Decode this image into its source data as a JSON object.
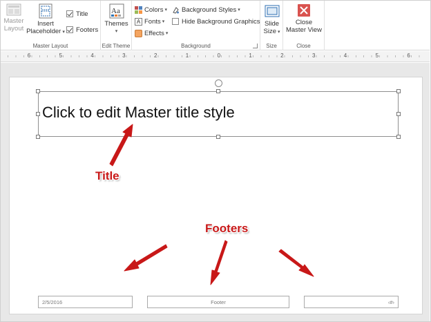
{
  "ribbon": {
    "master_layout": {
      "master_layout_label_1": "Master",
      "master_layout_label_2": "Layout",
      "insert_placeholder_label_1": "Insert",
      "insert_placeholder_label_2": "Placeholder",
      "title_checkbox": {
        "label": "Title",
        "checked": true
      },
      "footers_checkbox": {
        "label": "Footers",
        "checked": true
      },
      "group_label": "Master Layout"
    },
    "edit_theme": {
      "themes_label": "Themes",
      "group_label": "Edit Theme"
    },
    "background": {
      "colors_label": "Colors",
      "fonts_label": "Fonts",
      "effects_label": "Effects",
      "background_styles_label": "Background Styles",
      "hide_bg_graphics": {
        "label": "Hide Background Graphics",
        "checked": false
      },
      "group_label": "Background"
    },
    "size": {
      "slide_size_label_1": "Slide",
      "slide_size_label_2": "Size",
      "group_label": "Size"
    },
    "close": {
      "close_label_1": "Close",
      "close_label_2": "Master View",
      "group_label": "Close"
    }
  },
  "ruler": {
    "labels": [
      "6",
      "5",
      "4",
      "3",
      "2",
      "1",
      "0",
      "1",
      "2",
      "3",
      "4",
      "5",
      "6"
    ]
  },
  "slide": {
    "title_placeholder_text": "Click to edit Master title style",
    "footer_date": "2/5/2016",
    "footer_text": "Footer",
    "footer_slide_number": "‹#›"
  },
  "annotations": {
    "title_callout": "Title",
    "footers_callout": "Footers",
    "color": "#c81818"
  },
  "icons": [
    "master-layout-icon",
    "insert-placeholder-icon",
    "themes-icon",
    "colors-icon",
    "fonts-icon",
    "effects-icon",
    "background-styles-icon",
    "slide-size-icon",
    "close-master-view-icon",
    "rotate-handle-icon"
  ]
}
